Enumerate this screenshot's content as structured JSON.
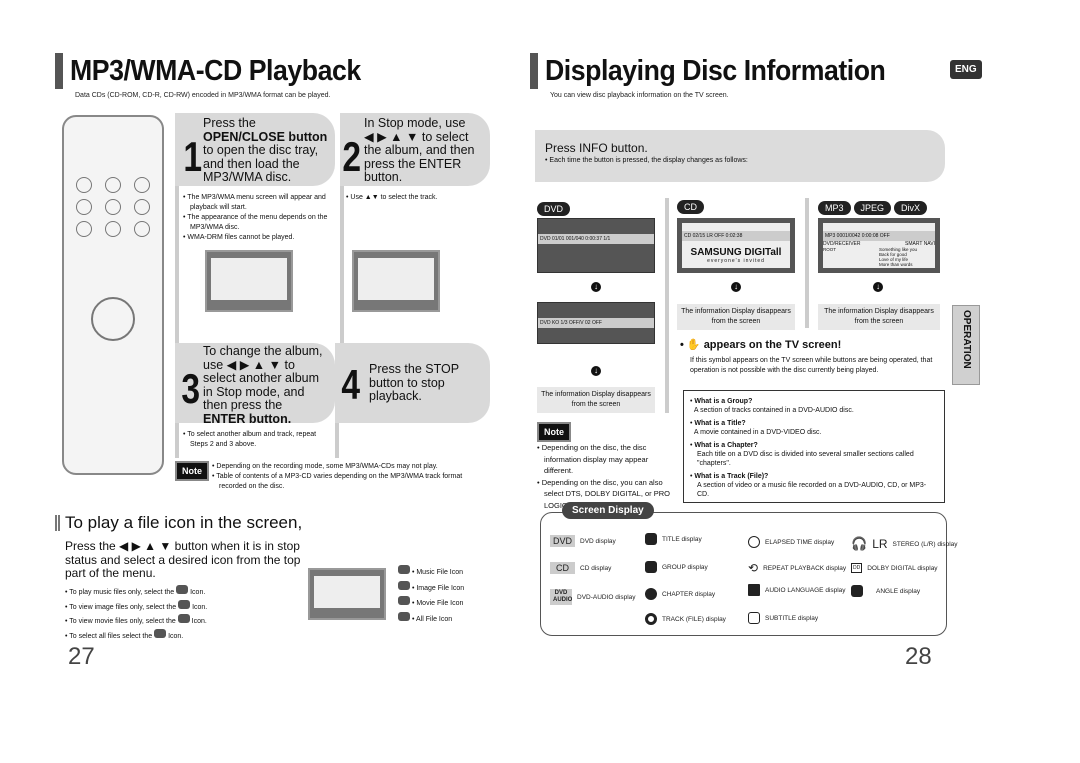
{
  "left": {
    "title": "MP3/WMA-CD Playback",
    "subtitle": "Data CDs (CD-ROM, CD-R, CD-RW) encoded in MP3/WMA format can be played.",
    "steps": [
      {
        "num": "1",
        "lines": [
          "Press the",
          "OPEN/CLOSE button",
          "to open the disc tray,",
          "and then load the",
          "MP3/WMA disc."
        ],
        "bullets": [
          "The MP3/WMA menu screen will appear and playback will start.",
          "The appearance of the menu depends on the MP3/WMA disc.",
          "WMA-DRM files cannot be played."
        ]
      },
      {
        "num": "2",
        "lines": [
          "In Stop mode, use",
          "◀ ▶ ▲ ▼  to select",
          "the album, and then",
          "press the ENTER",
          "button."
        ],
        "bullets": [
          "Use ▲▼ to select the track."
        ]
      },
      {
        "num": "3",
        "lines": [
          "To change the album,",
          "use ◀ ▶ ▲ ▼ to",
          "select another album",
          "in Stop mode, and",
          "then press the",
          "ENTER button."
        ],
        "bullets": [
          "To select another album and track, repeat Steps 2 and 3 above."
        ]
      },
      {
        "num": "4",
        "lines": [
          "Press the STOP",
          "button to stop",
          "playback."
        ],
        "bullets": []
      }
    ],
    "note_label": "Note",
    "notes": [
      "Depending on the recording mode, some MP3/WMA-CDs may not play.",
      "Table of contents of a MP3-CD varies depending on the MP3/WMA track format recorded on the disc."
    ],
    "file_icon": {
      "heading": "To play a file icon in the screen,",
      "intro": "Press the ◀ ▶ ▲ ▼ button when it is in stop status and select a desired icon from the top part of the menu.",
      "bullets": [
        {
          "pre": "To play music files only, select the",
          "post": "Icon.",
          "icon": "music-file-icon"
        },
        {
          "pre": "To view image files only, select the",
          "post": "Icon.",
          "icon": "image-file-icon"
        },
        {
          "pre": "To view movie files only, select the",
          "post": "Icon.",
          "icon": "movie-file-icon"
        },
        {
          "pre": "To select all files select the",
          "post": "Icon.",
          "icon": "all-file-icon"
        }
      ],
      "legend": [
        "Music File Icon",
        "Image File Icon",
        "Movie File Icon",
        "All File Icon"
      ]
    },
    "page_number": "27"
  },
  "right": {
    "title": "Displaying Disc Information",
    "badge": "ENG",
    "subtitle": "You can view disc playback information  on the TV screen.",
    "info_heading": "Press INFO button.",
    "info_bullet": "Each time the button is pressed, the display changes as follows:",
    "columns": [
      {
        "pills": [
          "DVD"
        ],
        "osd": "DVD  01/01  001/040  0:00:37  1/1",
        "osd2": "DVD  KO 1/3  OFF/V 02  OFF"
      },
      {
        "pills": [
          "CD"
        ],
        "osd": "CD  02/15  LR  OFF  0:02:38",
        "logo": "SAMSUNG DIGITall",
        "logo_sub": "everyone's invited"
      },
      {
        "pills": [
          "MP3",
          "JPEG",
          "DivX"
        ],
        "osd": "MP3  0001/0042  0:00:08  OFF",
        "list_header": "DVD/RECEIVER",
        "list_nav": "SMART NAVI",
        "root": "ROOT",
        "tracks": [
          "Something like you",
          "Back for good",
          "Love of my life",
          "More than words"
        ]
      }
    ],
    "disappears": "The information Display disappears from the screen",
    "hand_heading": "appears on the TV screen!",
    "hand_text": "If this symbol appears on the TV screen while buttons are being operated, that operation is not possible with the disc currently being played.",
    "note_label": "Note",
    "notes": [
      "Depending on the disc, the disc information display may appear different.",
      "Depending on the disc, you can also select DTS, DOLBY DIGITAL, or PRO LOGIC."
    ],
    "glossary": [
      {
        "q": "What is a Group?",
        "a": "A section of tracks contained in a DVD-AUDIO disc."
      },
      {
        "q": "What is a Title?",
        "a": "A movie contained in a DVD-VIDEO disc."
      },
      {
        "q": "What is a Chapter?",
        "a": "Each title on a DVD disc is divided into several smaller sections called \"chapters\"."
      },
      {
        "q": "What is a Track (File)?",
        "a": "A section of video or a music file recorded on a DVD-AUDIO, CD, or MP3-CD."
      }
    ],
    "side_tab": "OPERATION",
    "screen_display": {
      "label": "Screen Display",
      "items": [
        {
          "badge": "DVD",
          "text": "DVD display"
        },
        {
          "badge": "CD",
          "text": "CD display"
        },
        {
          "badge": "DVD AUDIO",
          "text": "DVD-AUDIO display"
        },
        {
          "icon": "title-icon",
          "text": "TITLE display"
        },
        {
          "icon": "group-icon",
          "text": "GROUP display"
        },
        {
          "icon": "chapter-icon",
          "text": "CHAPTER display"
        },
        {
          "icon": "track-icon",
          "text": "TRACK (FILE) display"
        },
        {
          "icon": "clock-icon",
          "text": "ELAPSED TIME display"
        },
        {
          "icon": "repeat-icon",
          "text": "REPEAT PLAYBACK display"
        },
        {
          "icon": "audio-language-icon",
          "text": "AUDIO LANGUAGE display"
        },
        {
          "icon": "subtitle-icon",
          "text": "SUBTITLE display"
        },
        {
          "icon": "headphones-icon",
          "badge": "LR",
          "text": "STEREO (L/R) display"
        },
        {
          "icon": "dolby-icon",
          "text": "DOLBY DIGITAL display"
        },
        {
          "icon": "angle-icon",
          "text": "ANGLE display"
        }
      ]
    },
    "page_number": "28"
  }
}
